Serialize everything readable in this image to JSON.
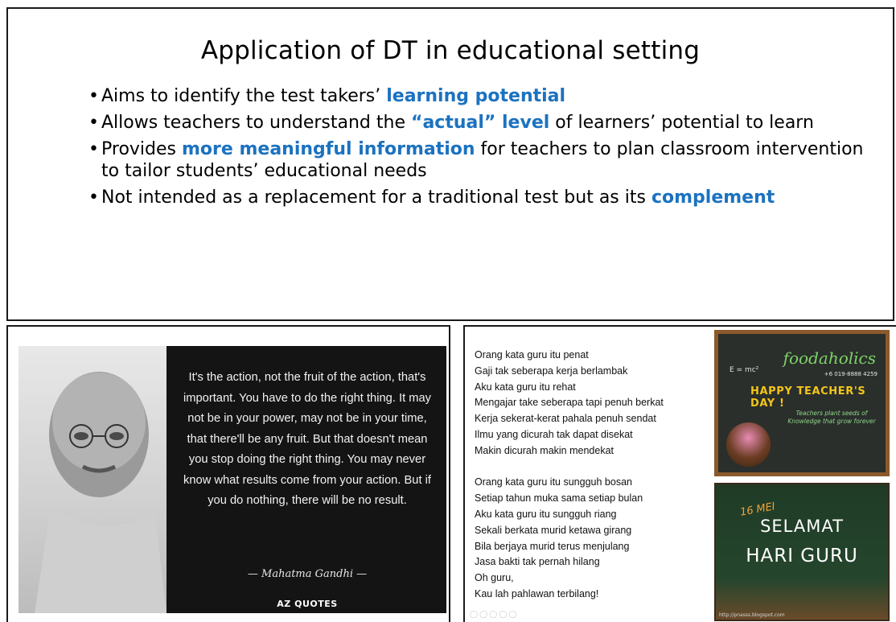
{
  "top_slide": {
    "title": "Application of DT in educational setting",
    "bullets": [
      {
        "pre": "Aims to identify the test takers’ ",
        "hl": "learning potential",
        "post": ""
      },
      {
        "pre": "Allows teachers to understand the ",
        "hl": "“actual” level",
        "post": " of learners’ potential to learn"
      },
      {
        "pre": "Provides ",
        "hl": "more meaningful information",
        "post": " for teachers to plan classroom intervention to tailor students’ educational needs"
      },
      {
        "pre": "Not intended as a replacement for a traditional test but as its ",
        "hl": "complement",
        "post": ""
      }
    ]
  },
  "quote_slide": {
    "quote": "It's the action, not the fruit of the action, that's important. You have to do the right thing. It may not be in your power, may not be in your time, that there'll be any fruit. But that doesn't mean you stop doing the right thing. You may never know what results come from your action. But if you do nothing, there will be no result.",
    "author": "— Mahatma Gandhi —",
    "logo": "AZ QUOTES"
  },
  "poem_slide": {
    "stanza1": [
      "Orang kata guru itu penat",
      "Gaji tak seberapa kerja berlambak",
      "Aku kata guru itu rehat",
      "Mengajar take seberapa tapi penuh berkat",
      "Kerja sekerat-kerat pahala penuh sendat",
      "Ilmu yang dicurah tak dapat disekat",
      "Makin dicurah makin mendekat"
    ],
    "stanza2": [
      "Orang kata guru itu sungguh bosan",
      "Setiap tahun muka sama setiap bulan",
      "Aku kata guru itu sungguh riang",
      "Sekali berkata murid ketawa girang",
      "Bila berjaya murid terus menjulang",
      "Jasa bakti tak pernah hilang",
      "Oh guru,",
      "Kau lah pahlawan terbilang!"
    ],
    "card1": {
      "brand": "foodaholics",
      "phone": "+6 019-8888 4259",
      "formula": "E = mc²",
      "greeting": "HAPPY TEACHER'S DAY !",
      "tagline": "Teachers plant seeds of Knowledge that grow forever"
    },
    "card2": {
      "date": "16 MEI",
      "line1": "SELAMAT",
      "line2": "HARI GURU",
      "url": "http://pnasss.blogspot.com"
    }
  }
}
